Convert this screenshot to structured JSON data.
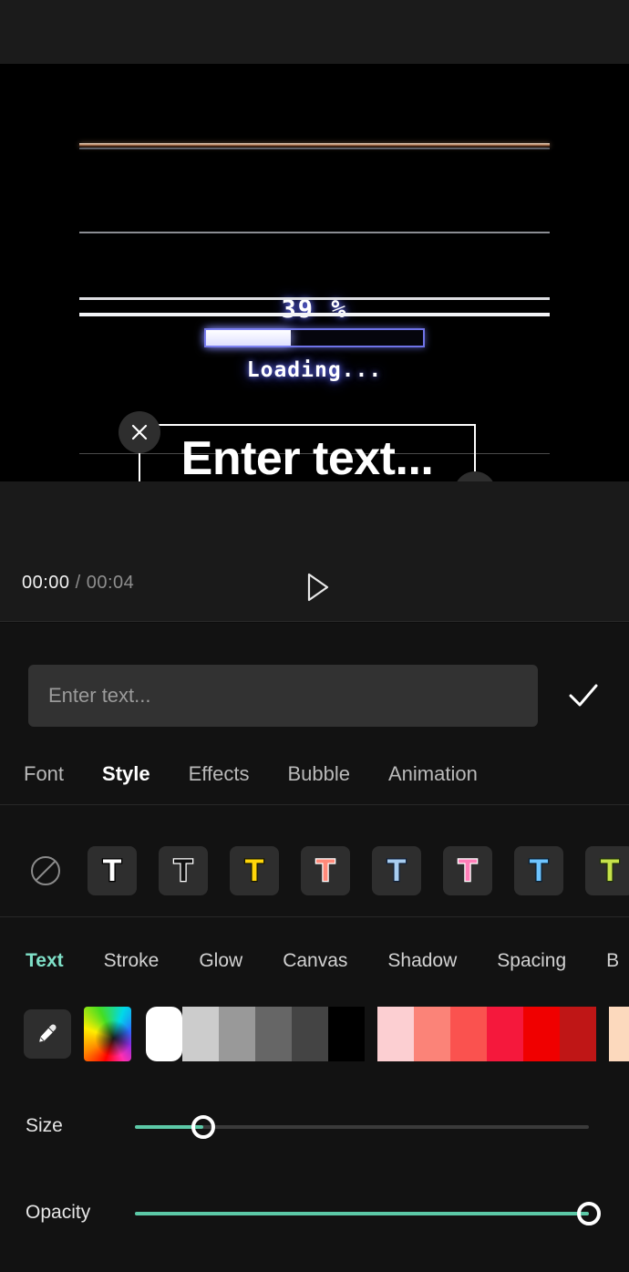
{
  "theme": {
    "accent": "#7fe0c8",
    "panel_bg": "#121212",
    "preview_bg": "#000000",
    "topbar_bg": "#1b1b1b"
  },
  "preview": {
    "loading_percent_label": "39 %",
    "progress_percent": 39,
    "loading_label": "Loading...",
    "overlay_text": "Enter text...",
    "delete_handle_icon": "close-icon",
    "resize_handle_icon": "resize-icon"
  },
  "playback": {
    "current_time": "00:00",
    "separator": "/",
    "duration": "00:04",
    "play_icon": "play-icon"
  },
  "text_input": {
    "value": "",
    "placeholder": "Enter text...",
    "confirm_icon": "check-icon"
  },
  "main_tabs": [
    {
      "label": "Font",
      "active": false
    },
    {
      "label": "Style",
      "active": true
    },
    {
      "label": "Effects",
      "active": false
    },
    {
      "label": "Bubble",
      "active": false
    },
    {
      "label": "Animation",
      "active": false
    }
  ],
  "style_presets": {
    "none_icon": "no-style-icon",
    "items": [
      {
        "name": "white",
        "glyph": "T",
        "fill": "#ffffff",
        "stroke": "#000000"
      },
      {
        "name": "black-outline",
        "glyph": "T",
        "fill": "#111111",
        "stroke": "#ffffff"
      },
      {
        "name": "yellow",
        "glyph": "T",
        "fill": "#ffd60a",
        "stroke": "#1a1a00"
      },
      {
        "name": "salmon",
        "glyph": "T",
        "fill": "#ff8a7a",
        "stroke": "#ffffff"
      },
      {
        "name": "light-blue",
        "glyph": "T",
        "fill": "#a8cdf0",
        "stroke": "#10203a"
      },
      {
        "name": "pink",
        "glyph": "T",
        "fill": "#ff7fb8",
        "stroke": "#ffffff"
      },
      {
        "name": "blue",
        "glyph": "T",
        "fill": "#6ec4ff",
        "stroke": "#0a2236"
      },
      {
        "name": "lime",
        "glyph": "T",
        "fill": "#c6e24a",
        "stroke": "#22330a"
      }
    ]
  },
  "sub_tabs": [
    {
      "label": "Text",
      "active": true
    },
    {
      "label": "Stroke",
      "active": false
    },
    {
      "label": "Glow",
      "active": false
    },
    {
      "label": "Canvas",
      "active": false
    },
    {
      "label": "Shadow",
      "active": false
    },
    {
      "label": "Spacing",
      "active": false
    },
    {
      "label": "B",
      "active": false
    }
  ],
  "color_palette": {
    "eyedropper_icon": "eyedropper-icon",
    "rainbow_icon": "color-wheel-icon",
    "selected_index": 0,
    "swatches": [
      {
        "hex": "#ffffff",
        "selected": true
      },
      {
        "hex": "#cccccc",
        "selected": false
      },
      {
        "hex": "#999999",
        "selected": false
      },
      {
        "hex": "#666666",
        "selected": false
      },
      {
        "hex": "#444444",
        "selected": false
      },
      {
        "hex": "#000000",
        "selected": false
      },
      {
        "gap": true
      },
      {
        "hex": "#fccfd2",
        "selected": false
      },
      {
        "hex": "#fb8378",
        "selected": false
      },
      {
        "hex": "#fa524f",
        "selected": false
      },
      {
        "hex": "#f5183c",
        "selected": false
      },
      {
        "hex": "#f00000",
        "selected": false
      },
      {
        "hex": "#bf1616",
        "selected": false
      },
      {
        "gap": true
      },
      {
        "hex": "#fcd9bd",
        "selected": false
      },
      {
        "hex": "#f9a876",
        "selected": false
      }
    ]
  },
  "sliders": [
    {
      "label": "Size",
      "value": 15,
      "fill": "#5cc9a7"
    },
    {
      "label": "Opacity",
      "value": 100,
      "fill": "#5cc9a7"
    }
  ]
}
